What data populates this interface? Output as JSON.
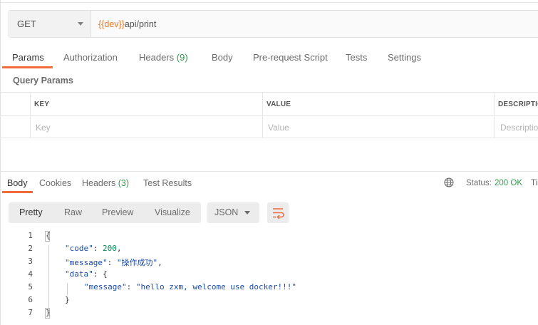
{
  "request": {
    "method": "GET",
    "url_var": "{{dev}}",
    "url_path": "api/print"
  },
  "request_tabs": {
    "params": "Params",
    "authorization": "Authorization",
    "headers": "Headers",
    "headers_count": "(9)",
    "body": "Body",
    "prerequest": "Pre-request Script",
    "tests": "Tests",
    "settings": "Settings"
  },
  "query_params": {
    "title": "Query Params",
    "columns": [
      "KEY",
      "VALUE",
      "DESCRIPTION"
    ],
    "placeholders": [
      "Key",
      "Value",
      "Description"
    ]
  },
  "response_tabs": {
    "body": "Body",
    "cookies": "Cookies",
    "headers": "Headers",
    "headers_count": "(3)",
    "test_results": "Test Results"
  },
  "status": {
    "label": "Status:",
    "value": "200 OK",
    "time_label": "Time"
  },
  "view_modes": [
    "Pretty",
    "Raw",
    "Preview",
    "Visualize"
  ],
  "format": "JSON",
  "icons": {
    "method_dropdown": "chevron-down-icon",
    "globe": "globe-icon",
    "format_dropdown": "chevron-down-icon",
    "wrap": "wrap-lines-icon"
  },
  "colors": {
    "accent": "#f26b3a",
    "success": "#2e9c4a",
    "variable": "#e6792c"
  },
  "response_body": {
    "line_numbers": [
      "1",
      "2",
      "3",
      "4",
      "5",
      "6",
      "7"
    ],
    "open_brace": "{",
    "code_key": "\"code\"",
    "code_value": "200",
    "message_key": "\"message\"",
    "message_value": "\"操作成功\"",
    "data_key": "\"data\"",
    "data_open": "{",
    "inner_message_key": "\"message\"",
    "inner_message_value": "\"hello zxm, welcome use docker!!!\"",
    "data_close": "}",
    "close_brace": "}"
  }
}
